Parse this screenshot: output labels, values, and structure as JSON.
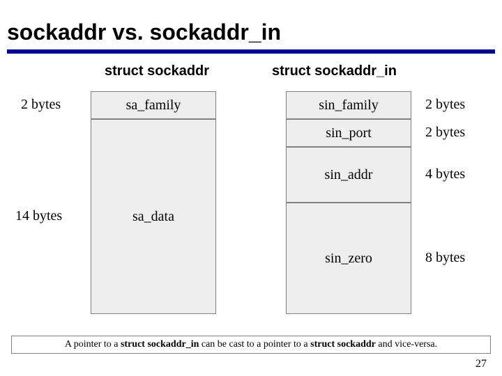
{
  "title": "sockaddr vs. sockaddr_in",
  "left": {
    "header": "struct sockaddr",
    "rows": [
      {
        "label": "sa_family",
        "size": "2 bytes"
      },
      {
        "label": "sa_data",
        "size": "14 bytes"
      }
    ]
  },
  "right": {
    "header": "struct sockaddr_in",
    "rows": [
      {
        "label": "sin_family",
        "size": "2 bytes"
      },
      {
        "label": "sin_port",
        "size": "2 bytes"
      },
      {
        "label": "sin_addr",
        "size": "4 bytes"
      },
      {
        "label": "sin_zero",
        "size": "8 bytes"
      }
    ]
  },
  "footnote": {
    "prefix": "A pointer to a ",
    "bold1": "struct sockaddr_in",
    "mid": " can be cast to a pointer to a ",
    "bold2": "struct sockaddr",
    "suffix": " and vice-versa."
  },
  "page": "27"
}
